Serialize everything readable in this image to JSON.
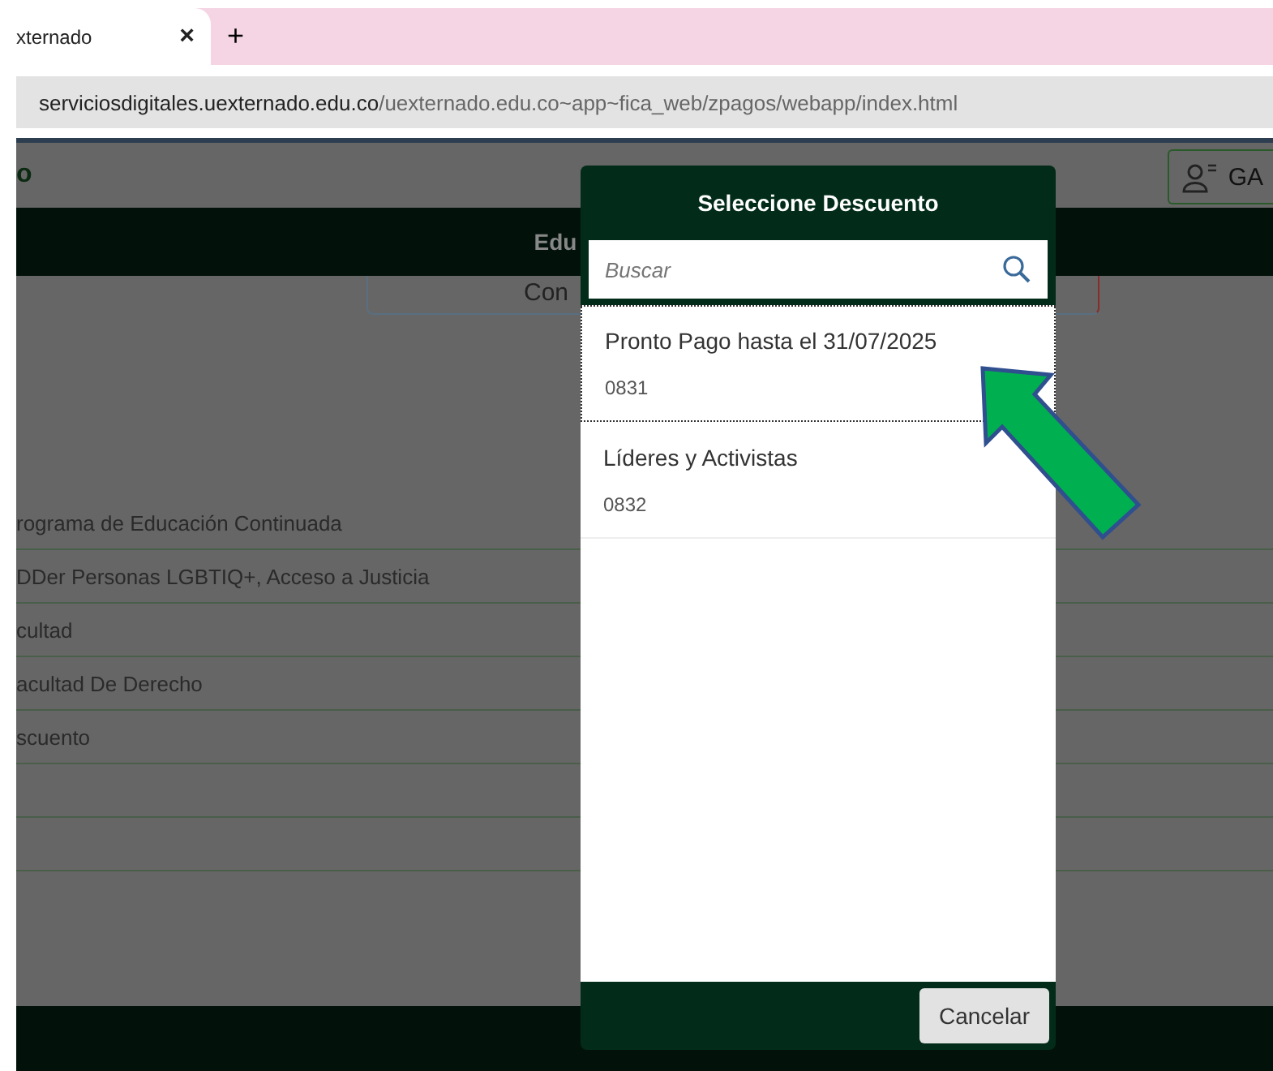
{
  "browser": {
    "tab": {
      "title": "xternado",
      "close": "×"
    },
    "new_tab": "+",
    "address": {
      "host": "serviciosdigitales.uexternado.edu.co",
      "path": "/uexternado.edu.co~app~fica_web/zpagos/webapp/index.html"
    }
  },
  "page": {
    "logo": "o",
    "user_button": "GA",
    "band_title": "Edu",
    "button": "Con",
    "rows": [
      {
        "text": "rograma de Educación Continuada"
      },
      {
        "text": "DDer Personas LGBTIQ+, Acceso a Justicia"
      },
      {
        "text": "cultad"
      },
      {
        "text": "acultad De Derecho"
      },
      {
        "text": "scuento"
      }
    ]
  },
  "dialog": {
    "title": "Seleccione Descuento",
    "search": {
      "placeholder": "Buscar"
    },
    "items": [
      {
        "name": "Pronto Pago hasta el 31/07/2025",
        "code": "0831",
        "selected": true
      },
      {
        "name": "Líderes y Activistas",
        "code": "0832",
        "selected": false
      }
    ],
    "buttons": [
      "Cancelar"
    ]
  }
}
